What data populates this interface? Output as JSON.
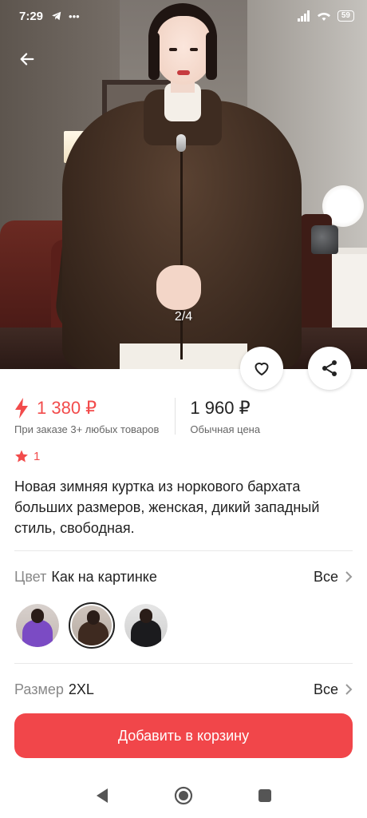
{
  "status_bar": {
    "time": "7:29",
    "battery": "59"
  },
  "hero": {
    "page_indicator": "2/4"
  },
  "prices": {
    "promo_price": "1 380 ₽",
    "promo_caption": "При заказе 3+ любых товаров",
    "regular_price": "1 960 ₽",
    "regular_caption": "Обычная цена"
  },
  "rating": {
    "value": "1"
  },
  "product": {
    "title": "Новая зимняя куртка из норкового бархата больших размеров, женская, дикий западный стиль, свободная."
  },
  "color_option": {
    "label": "Цвет",
    "value": "Как на картинке",
    "all_label": "Все"
  },
  "size_option": {
    "label": "Размер",
    "value": "2XL",
    "all_label": "Все"
  },
  "swatches": [
    {
      "icon": "purple-coat-thumbnail",
      "color": "#7b4bc4",
      "selected": false
    },
    {
      "icon": "brown-coat-thumbnail",
      "color": "#3e2a20",
      "selected": true
    },
    {
      "icon": "black-coat-thumbnail",
      "color": "#1b1b1e",
      "selected": false
    }
  ],
  "cart": {
    "button_label": "Добавить в корзину"
  },
  "colors": {
    "accent": "#f1464a",
    "promo": "#f24b4b"
  }
}
